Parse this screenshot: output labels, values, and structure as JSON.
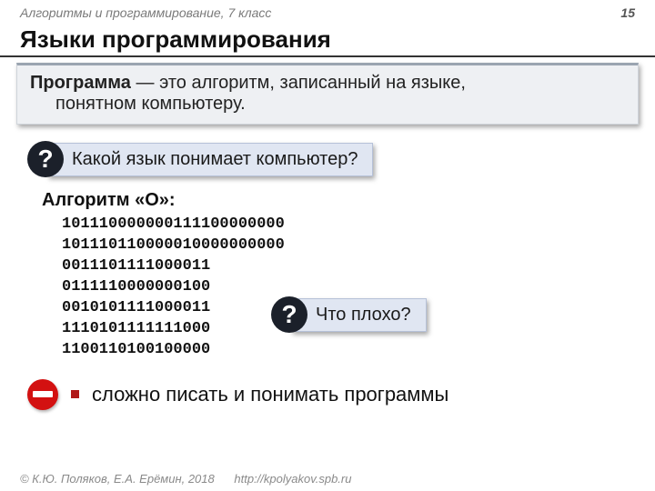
{
  "header": {
    "course": "Алгоритмы и программирование, 7 класс",
    "page": "15"
  },
  "title": "Языки программирования",
  "definition": {
    "term": "Программа",
    "dash": " — ",
    "line1_rest": "это алгоритм, записанный на языке,",
    "line2": "понятном компьютеру."
  },
  "q1": {
    "mark": "?",
    "text": "Какой язык понимает компьютер?"
  },
  "algo": {
    "title": "Алгоритм «О»:",
    "lines": [
      "101110000000111100000000",
      "101110110000010000000000",
      "0011101111000011",
      "0111110000000100",
      "0010101111000011",
      "1110101111111000",
      "1100110100100000"
    ]
  },
  "q2": {
    "mark": "?",
    "text": "Что плохо?"
  },
  "bullet": "сложно писать и понимать программы",
  "footer": {
    "copy": "© К.Ю. Поляков, Е.А. Ерёмин, 2018",
    "url": "http://kpolyakov.spb.ru"
  }
}
